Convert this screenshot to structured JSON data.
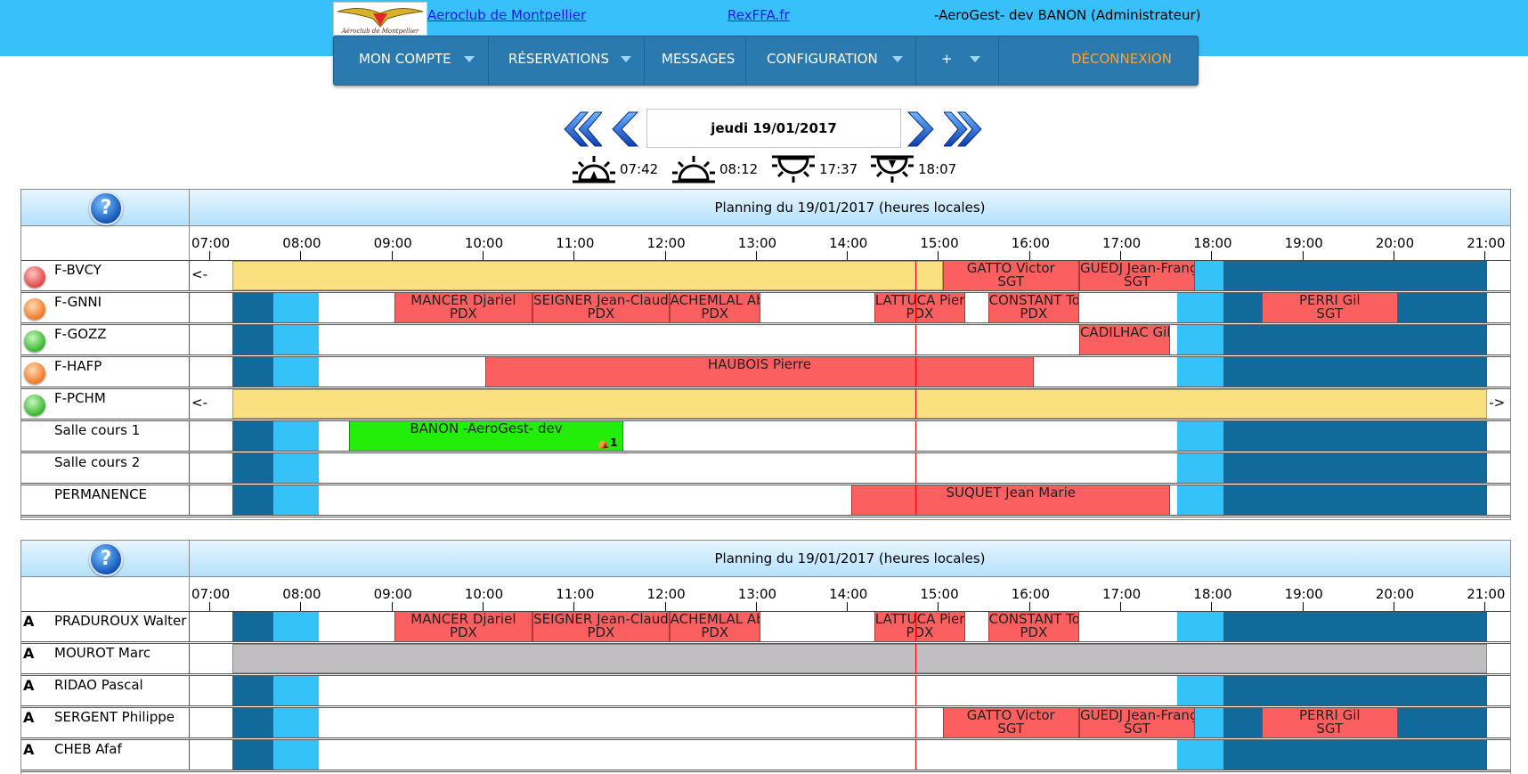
{
  "header": {
    "club_link": "Aeroclub de Montpellier",
    "rex_link": "RexFFA.fr",
    "user": "-AeroGest- dev BANON (Administrateur)",
    "logo_text": "Aéroclub de Montpellier"
  },
  "menu": {
    "account": "MON COMPTE",
    "reservations": "RÉSERVATIONS",
    "messages": "MESSAGES",
    "configuration": "CONFIGURATION",
    "plus": "+",
    "logout": "DÉCONNEXION"
  },
  "datebar": {
    "date": "jeudi 19/01/2017",
    "dawn": "07:42",
    "sunrise": "08:12",
    "sunset": "17:37",
    "dusk": "18:07"
  },
  "help_symbol": "?",
  "hours": [
    "07:00",
    "08:00",
    "09:00",
    "10:00",
    "11:00",
    "12:00",
    "13:00",
    "14:00",
    "15:00",
    "16:00",
    "17:00",
    "18:00",
    "19:00",
    "20:00",
    "21:00"
  ],
  "now_hour": 14.75,
  "colors": {
    "night": "#126a9a",
    "twilight": "#34c2f8",
    "reservation": "#fb5f5f",
    "own_reservation": "#22ee0a",
    "unavailable": "#fbe07f",
    "absent": "#c0bec0"
  },
  "resources": {
    "title": "Planning du 19/01/2017 (heures locales)",
    "rows": [
      {
        "name": "F-BVCY",
        "status": "red",
        "arrow_left": "<-",
        "arrow_right": "",
        "unavailable": [
          7.25,
          15.05
        ],
        "bookings": [
          {
            "start": 15.05,
            "end": 16.55,
            "l1": "GATTO Victor",
            "l2": "SGT"
          },
          {
            "start": 16.55,
            "end": 17.82,
            "l1": "GUEDJ Jean-Franç",
            "l2": "SGT"
          }
        ]
      },
      {
        "name": "F-GNNI",
        "status": "orange",
        "arrow_left": "",
        "arrow_right": "",
        "bookings": [
          {
            "start": 9.03,
            "end": 10.55,
            "l1": "MANCER Djariel",
            "l2": "PDX"
          },
          {
            "start": 10.55,
            "end": 12.05,
            "l1": "SEIGNER Jean-Claude",
            "l2": "PDX"
          },
          {
            "start": 12.05,
            "end": 13.05,
            "l1": "ACHEMLAL Ab",
            "l2": "PDX"
          },
          {
            "start": 14.3,
            "end": 15.3,
            "l1": "LATTUCA Pier",
            "l2": "PDX"
          },
          {
            "start": 15.55,
            "end": 16.55,
            "l1": "CONSTANT To",
            "l2": "PDX"
          },
          {
            "start": 18.55,
            "end": 20.05,
            "l1": "PERRI Gil",
            "l2": "SGT"
          }
        ]
      },
      {
        "name": "F-GOZZ",
        "status": "green",
        "arrow_left": "",
        "arrow_right": "",
        "bookings": [
          {
            "start": 16.55,
            "end": 17.55,
            "l1": "CADILHAC Gil",
            "l2": ""
          }
        ]
      },
      {
        "name": "F-HAFP",
        "status": "orange",
        "arrow_left": "",
        "arrow_right": "",
        "bookings": [
          {
            "start": 10.03,
            "end": 16.05,
            "l1": "HAUBOIS Pierre",
            "l2": ""
          }
        ]
      },
      {
        "name": "F-PCHM",
        "status": "green",
        "arrow_left": "<-",
        "arrow_right": "->",
        "unavailable": [
          7.25,
          21.03
        ],
        "bookings": []
      },
      {
        "name": "Salle cours 1",
        "status": "",
        "arrow_left": "",
        "arrow_right": "",
        "bookings": [
          {
            "start": 8.53,
            "end": 11.55,
            "l1": "BANON -AeroGest- dev",
            "l2": "",
            "own": true,
            "seat": "⛺1"
          }
        ]
      },
      {
        "name": "Salle cours 2",
        "status": "",
        "arrow_left": "",
        "arrow_right": "",
        "bookings": []
      },
      {
        "name": "PERMANENCE",
        "status": "",
        "arrow_left": "",
        "arrow_right": "",
        "bookings": [
          {
            "start": 14.05,
            "end": 17.55,
            "l1": "SUQUET Jean Marie",
            "l2": ""
          }
        ]
      }
    ]
  },
  "instructors": {
    "title": "Planning du 19/01/2017 (heures locales)",
    "rows": [
      {
        "name": "PRADUROUX Walter",
        "badge": "A",
        "bookings": [
          {
            "start": 9.03,
            "end": 10.55,
            "l1": "MANCER Djariel",
            "l2": "PDX"
          },
          {
            "start": 10.55,
            "end": 12.05,
            "l1": "SEIGNER Jean-Claude",
            "l2": "PDX"
          },
          {
            "start": 12.05,
            "end": 13.05,
            "l1": "ACHEMLAL Ab",
            "l2": "PDX"
          },
          {
            "start": 14.3,
            "end": 15.3,
            "l1": "LATTUCA Pier",
            "l2": "PDX"
          },
          {
            "start": 15.55,
            "end": 16.55,
            "l1": "CONSTANT To",
            "l2": "PDX"
          }
        ]
      },
      {
        "name": "MOUROT Marc",
        "badge": "A",
        "absent": [
          7.25,
          21.03
        ],
        "bookings": []
      },
      {
        "name": "RIDAO Pascal",
        "badge": "A",
        "bookings": []
      },
      {
        "name": "SERGENT Philippe",
        "badge": "A",
        "bookings": [
          {
            "start": 15.05,
            "end": 16.55,
            "l1": "GATTO Victor",
            "l2": "SGT"
          },
          {
            "start": 16.55,
            "end": 17.82,
            "l1": "GUEDJ Jean-Franç",
            "l2": "SGT"
          },
          {
            "start": 18.55,
            "end": 20.05,
            "l1": "PERRI Gil",
            "l2": "SGT"
          }
        ]
      },
      {
        "name": "CHEB Afaf",
        "badge": "A",
        "bookings": []
      }
    ]
  }
}
